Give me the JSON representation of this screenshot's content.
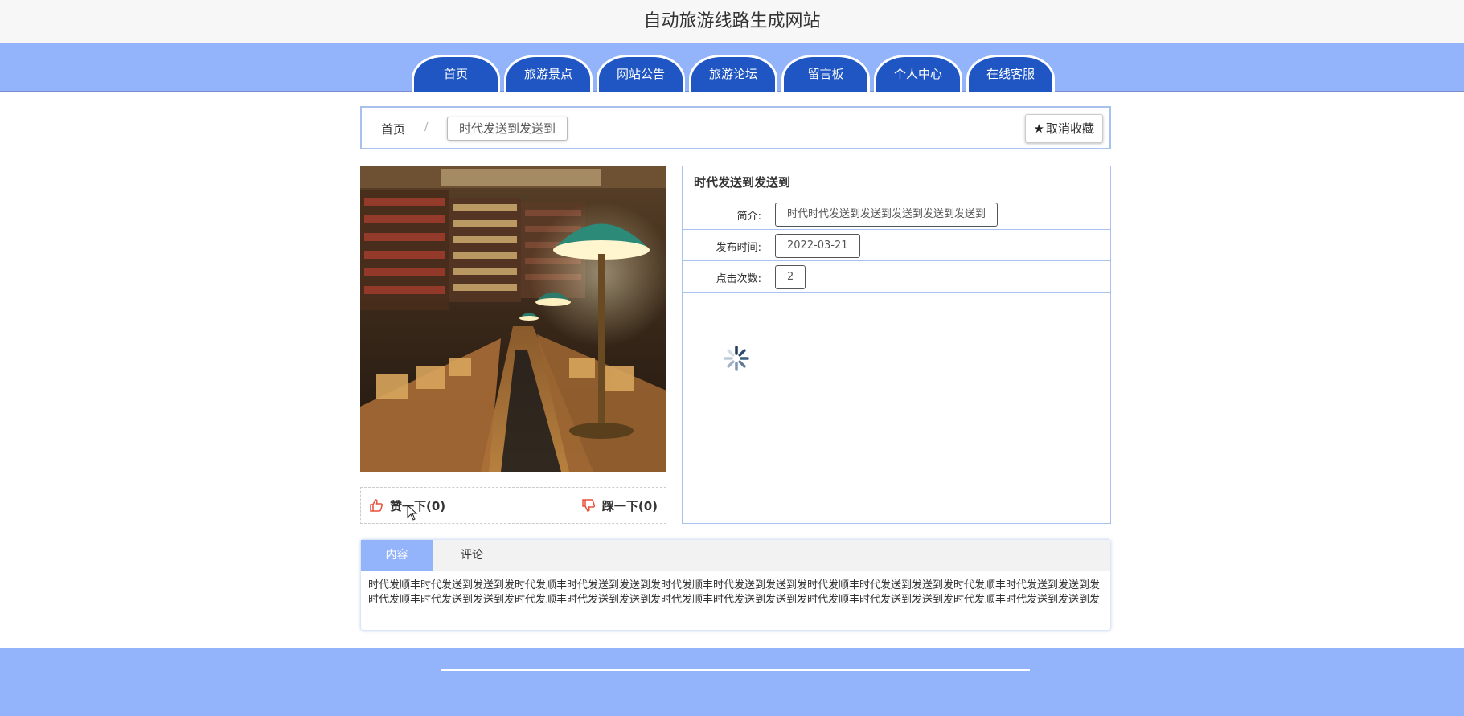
{
  "site": {
    "title": "自动旅游线路生成网站"
  },
  "nav": {
    "items": [
      {
        "label": "首页"
      },
      {
        "label": "旅游景点"
      },
      {
        "label": "网站公告"
      },
      {
        "label": "旅游论坛"
      },
      {
        "label": "留言板"
      },
      {
        "label": "个人中心"
      },
      {
        "label": "在线客服"
      }
    ]
  },
  "breadcrumb": {
    "home": "首页",
    "separator": "/",
    "current": "时代发送到发送到"
  },
  "favorite": {
    "label": "取消收藏",
    "icon": "star-icon"
  },
  "votes": {
    "like_label": "赞一下(0)",
    "dislike_label": "踩一下(0)",
    "like_icon": "thumbs-up-icon",
    "dislike_icon": "thumbs-down-icon",
    "icon_color": "#e8503a"
  },
  "info": {
    "title": "时代发送到发送到",
    "rows": [
      {
        "label": "简介:",
        "value": "时代时代发送到发送到发送到发送到发送到"
      },
      {
        "label": "发布时间:",
        "value": "2022-03-21"
      },
      {
        "label": "点击次数:",
        "value": "2"
      }
    ]
  },
  "tabs": {
    "items": [
      {
        "label": "内容"
      },
      {
        "label": "评论"
      }
    ],
    "active_index": 0,
    "content": "时代发顺丰时代发送到发送到发时代发顺丰时代发送到发送到发时代发顺丰时代发送到发送到发时代发顺丰时代发送到发送到发时代发顺丰时代发送到发送到发时代发顺丰时代发送到发送到发时代发顺丰时代发送到发送到发时代发顺丰时代发送到发送到发时代发顺丰时代发送到发送到发时代发顺丰时代发送到发送到发"
  },
  "colors": {
    "nav_band": "#93b4fb",
    "nav_tab": "#1f56c3",
    "border": "#a9c1ef",
    "footer": "#93b4fb"
  }
}
